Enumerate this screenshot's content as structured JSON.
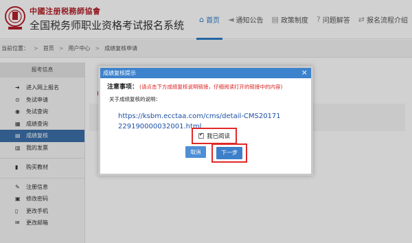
{
  "header": {
    "org_name": "中國注册税務師協會",
    "site_title": "全国税务师职业资格考试报名系统",
    "nav": [
      {
        "label": "首页",
        "icon": "home-icon",
        "active": true
      },
      {
        "label": "通知公告",
        "icon": "megaphone-icon",
        "active": false
      },
      {
        "label": "政策制度",
        "icon": "document-icon",
        "active": false
      },
      {
        "label": "问题解答",
        "icon": "question-icon",
        "active": false
      },
      {
        "label": "报名流程介绍",
        "icon": "flow-icon",
        "active": false
      }
    ]
  },
  "breadcrumb": {
    "prefix": "当前位置：",
    "items": [
      "首页",
      "用户中心",
      "成绩复核申请"
    ]
  },
  "sidebar": {
    "title": "报考信息",
    "items": [
      {
        "label": "进入网上报名",
        "icon": "enter-icon"
      },
      {
        "label": "免试申请",
        "icon": "exempt-icon"
      },
      {
        "label": "免试查询",
        "icon": "exempt-query-icon"
      },
      {
        "label": "成绩查询",
        "icon": "score-query-icon"
      },
      {
        "label": "成绩复核",
        "icon": "score-review-icon",
        "active": true
      },
      {
        "label": "我的发票",
        "icon": "invoice-icon"
      }
    ],
    "group2": [
      {
        "label": "购买教材",
        "icon": "book-icon"
      }
    ],
    "group3": [
      {
        "label": "注册信息",
        "icon": "wrench-icon"
      },
      {
        "label": "修改密码",
        "icon": "lock-icon"
      },
      {
        "label": "更改手机",
        "icon": "phone-icon"
      },
      {
        "label": "更改邮箱",
        "icon": "mail-icon"
      }
    ]
  },
  "dialog": {
    "title": "成绩复核提示",
    "close": "×",
    "notice_label": "注意事项：",
    "notice_red": "(请点击下方成绩复核说明链接，仔细阅读打开的链接中的内容)",
    "about": "关于成绩复核的说明：",
    "link": "https://ksbm.ecctaa.com/cms/detail-CMS20171229190000032001.html",
    "checkbox_label": "我已阅读",
    "cancel": "取消",
    "next": "下一步"
  },
  "colors": {
    "accent": "#2b7cc6",
    "dialog_title_bg": "#3d82cc",
    "highlight_red": "#e02828",
    "sidebar_active": "#3b6fa9"
  }
}
